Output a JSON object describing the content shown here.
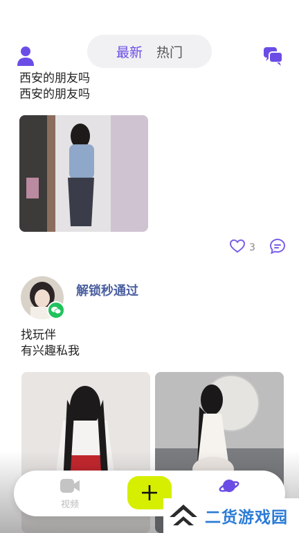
{
  "header": {
    "tabs": [
      {
        "label": "最新",
        "active": true
      },
      {
        "label": "热门",
        "active": false
      }
    ],
    "icons": {
      "left": "user-icon",
      "right": "chat-bubbles-icon"
    },
    "accent_color": "#6b4de6"
  },
  "feed": {
    "posts": [
      {
        "text_lines": [
          "西安的朋友吗",
          "西安的朋友吗"
        ],
        "like_count": "3"
      },
      {
        "username": "解锁秒通过",
        "text_lines": [
          "找玩伴",
          "有兴趣私我"
        ]
      }
    ]
  },
  "bottom_nav": {
    "video_label": "视频",
    "icons": [
      "video-camera-icon",
      "plus-icon",
      "planet-icon"
    ],
    "plus_color": "#d6ef00"
  },
  "watermark": {
    "text": "二货游戏园"
  }
}
